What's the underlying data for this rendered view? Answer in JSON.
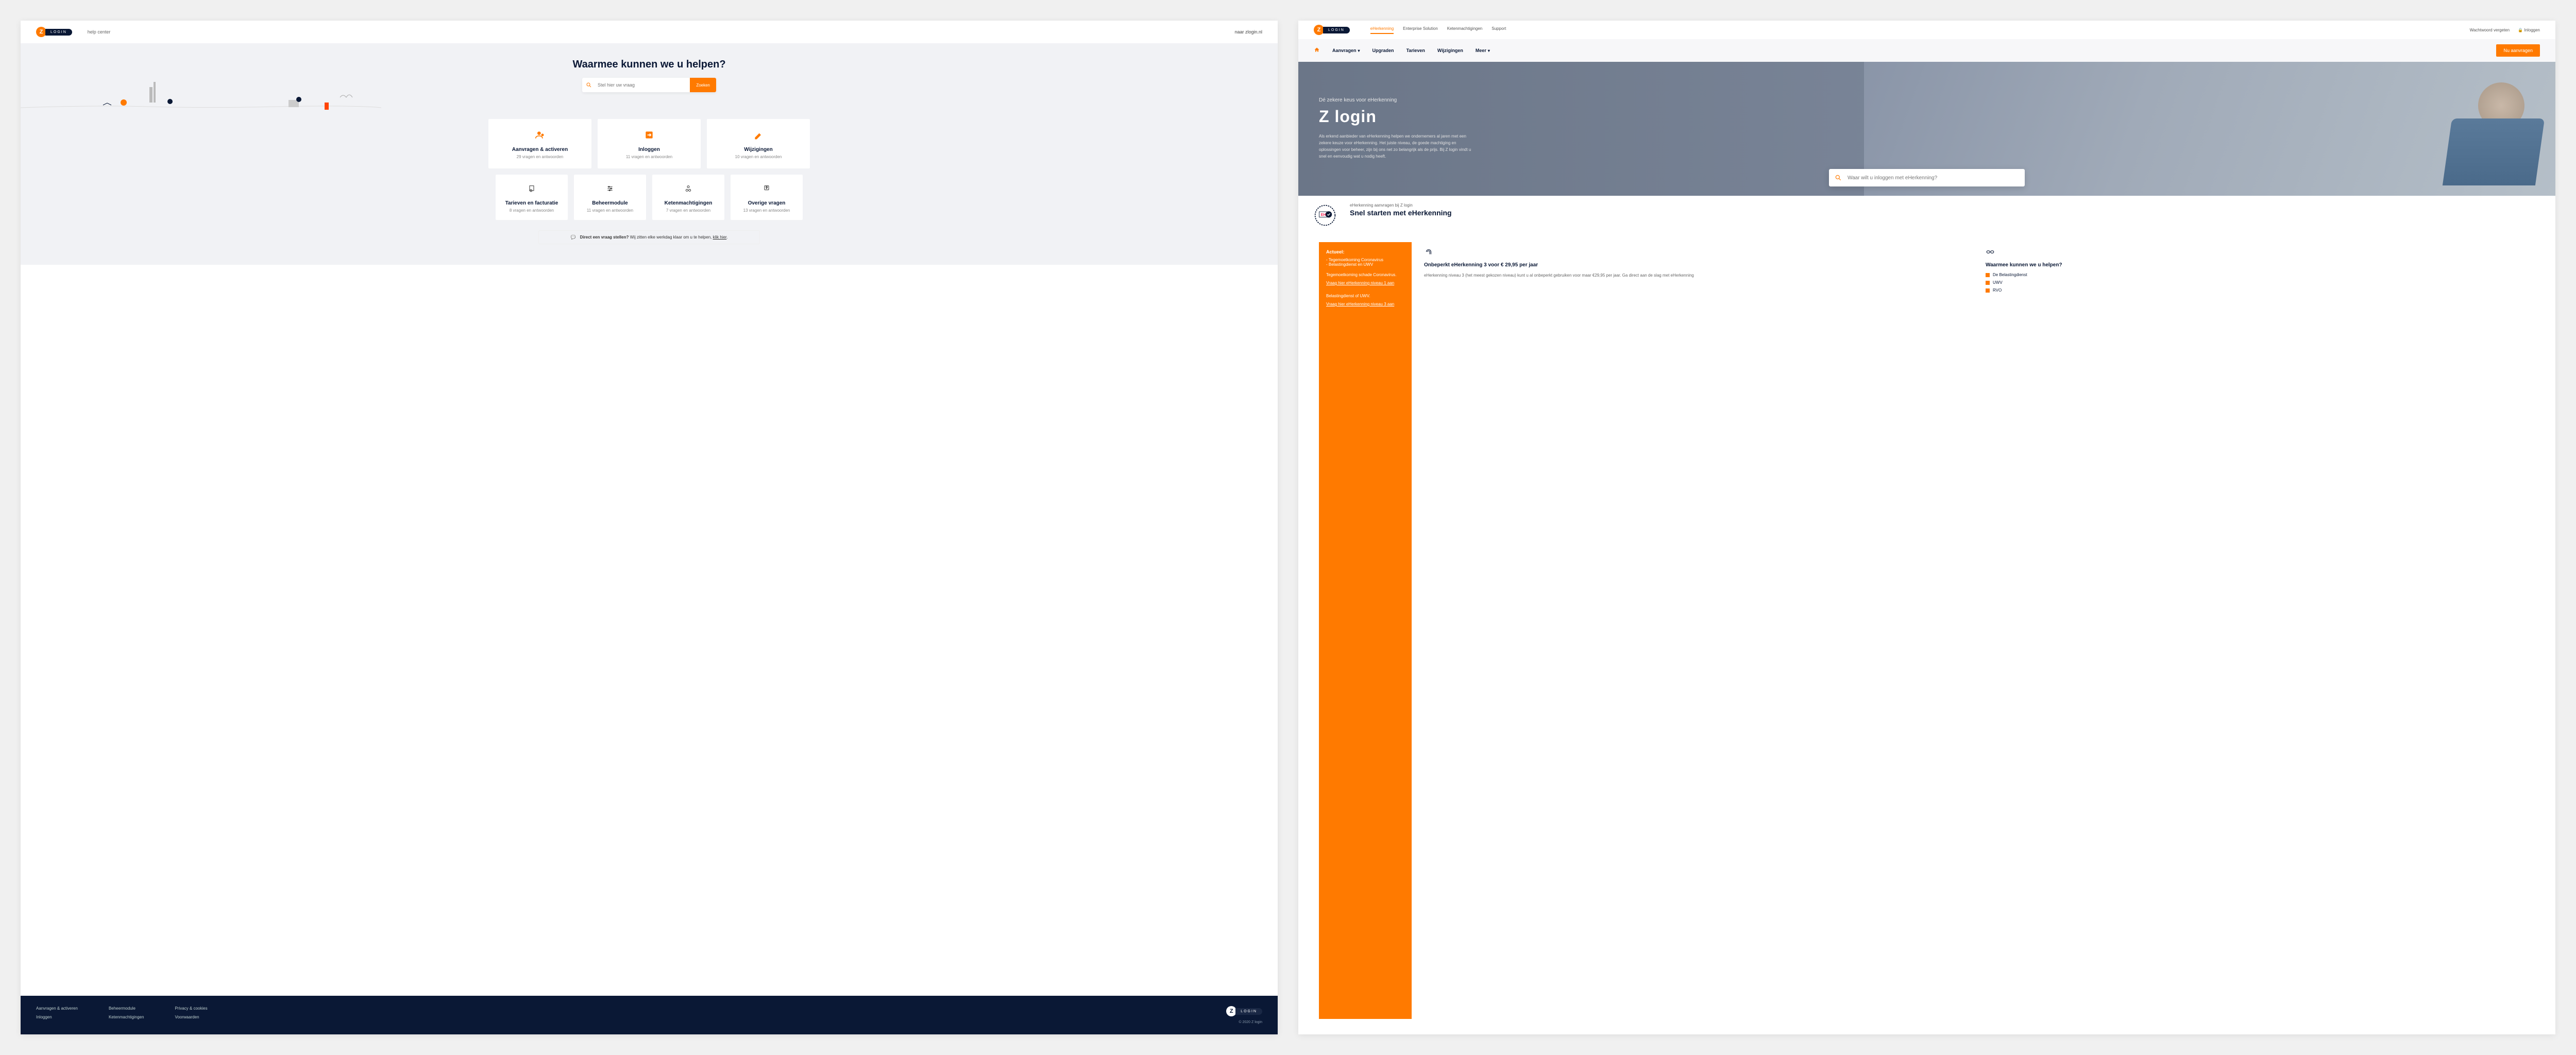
{
  "left": {
    "logo": {
      "letter": "Z",
      "text": "LOGIN"
    },
    "topLink": "help center",
    "topRight": "naar zlogin.nl",
    "heroTitle": "Waarmee kunnen we u helpen?",
    "search": {
      "placeholder": "Stel hier uw vraag",
      "button": "Zoeken"
    },
    "cardsTop": [
      {
        "title": "Aanvragen & activeren",
        "sub": "29 vragen en antwoorden"
      },
      {
        "title": "Inloggen",
        "sub": "11 vragen en antwoorden"
      },
      {
        "title": "Wijzigingen",
        "sub": "10 vragen en antwoorden"
      }
    ],
    "cardsBottom": [
      {
        "title": "Tarieven en facturatie",
        "sub": "8 vragen en antwoorden"
      },
      {
        "title": "Beheermodule",
        "sub": "11 vragen en antwoorden"
      },
      {
        "title": "Ketenmachtigingen",
        "sub": "7 vragen en antwoorden"
      },
      {
        "title": "Overige vragen",
        "sub": "13 vragen en antwoorden"
      }
    ],
    "banner": {
      "bold": "Direct een vraag stellen?",
      "text": " Wij zitten elke werkdag klaar om u te helpen, ",
      "link": "klik hier"
    },
    "footer": {
      "col1": [
        "Aanvragen & activeren",
        "Inloggen"
      ],
      "col2": [
        "Beheermodule",
        "Ketenmachtigingen"
      ],
      "col3": [
        "Privacy & cookies",
        "Voorwaarden"
      ],
      "copy": "© 2020 Z login"
    }
  },
  "right": {
    "logo": {
      "letter": "Z",
      "text": "LOGIN"
    },
    "topNav": [
      "eHerkenning",
      "Enterprise Solution",
      "Ketenmachtigingen",
      "Support"
    ],
    "topRight": {
      "forgot": "Wachtwoord vergeten",
      "login": "Inloggen"
    },
    "subNav": [
      "Aanvragen",
      "Upgraden",
      "Tarieven",
      "Wijzigingen",
      "Meer"
    ],
    "cta": "Nu aanvragen",
    "hero": {
      "kicker": "Dé zekere keus voor eHerkenning",
      "title": "Z login",
      "body": "Als erkend aanbieder van eHerkenning helpen we ondernemers al jaren met een zekere keuze voor eHerkenning. Het juiste niveau, de goede machtiging en oplossingen voor beheer, zijn bij ons net zo belangrijk als de prijs. Bij Z login vindt u snel en eenvoudig wat u nodig heeft.",
      "searchPlaceholder": "Waar wilt u inloggen met eHerkenning?"
    },
    "section": {
      "kicker": "eHerkenning aanvragen bij Z login",
      "title": "Snel starten met eHerkenning"
    },
    "actueel": {
      "title": "Actueel:",
      "items": [
        "Tegemoetkoming Coronavirus",
        "Belastingdienst en UWV"
      ],
      "p1": "Tegemoetkoming schade Coronavirus.",
      "link1": "Vraag hier eHerkenning niveau 1 aan",
      "p2": "Belastingdienst of UWV.",
      "link2": "Vraag hier eHerkenning niveau 3 aan"
    },
    "col1": {
      "title": "Onbeperkt eHerkenning 3 voor € 29,95 per jaar",
      "body": "eHerkenning niveau 3 (het meest gekozen niveau) kunt u al onbeperkt gebruiken voor maar €29,95 per jaar. Ga direct aan de slag met eHerkenning"
    },
    "col2": {
      "title": "Waarmee kunnen we u helpen?",
      "links": [
        "De Belastingdienst",
        "UWV",
        "RVO"
      ]
    }
  }
}
